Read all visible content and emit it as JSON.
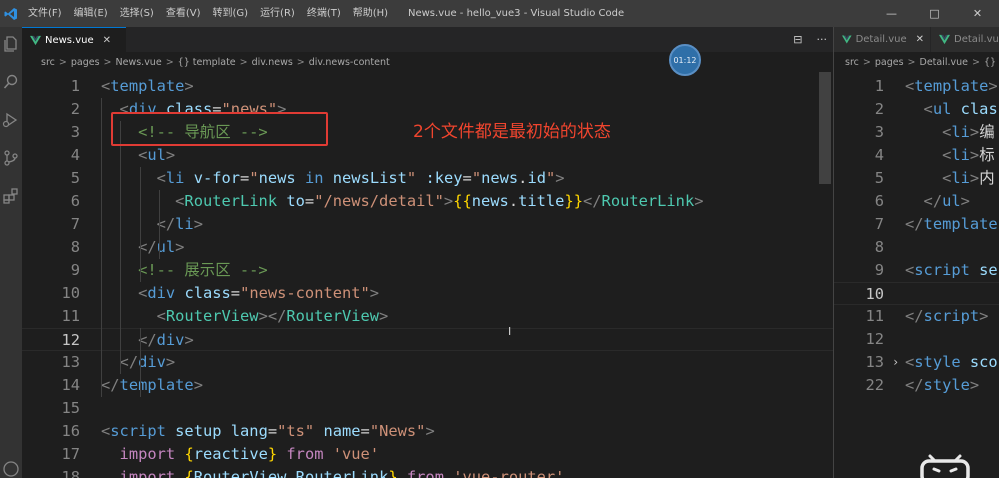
{
  "window": {
    "title": "News.vue - hello_vue3 - Visual Studio Code",
    "menu": [
      "文件(F)",
      "编辑(E)",
      "选择(S)",
      "查看(V)",
      "转到(G)",
      "运行(R)",
      "终端(T)",
      "帮助(H)"
    ],
    "controls": [
      "—",
      "□",
      "✕"
    ]
  },
  "activity_bar": [
    "explorer-icon",
    "search-icon",
    "run-debug-icon",
    "source-control-icon",
    "extensions-icon",
    "account-icon"
  ],
  "editor_left": {
    "tab": {
      "label": "News.vue",
      "close": "✕"
    },
    "actions": [
      "⊟",
      "···"
    ],
    "breadcrumb": [
      "src",
      "pages",
      "News.vue",
      "{} template",
      "div.news",
      "div.news-content"
    ],
    "breadcrumb_sep": ">",
    "line_numbers": [
      "1",
      "2",
      "3",
      "4",
      "5",
      "6",
      "7",
      "8",
      "9",
      "10",
      "11",
      "12",
      "13",
      "14",
      "15",
      "16",
      "17",
      "18"
    ],
    "active_line": "12",
    "code_lines": [
      [
        {
          "t": "<",
          "c": "punct"
        },
        {
          "t": "template",
          "c": "tag"
        },
        {
          "t": ">",
          "c": "punct"
        }
      ],
      [
        {
          "t": "  "
        },
        {
          "t": "<",
          "c": "punct"
        },
        {
          "t": "div",
          "c": "tag"
        },
        {
          "t": " class",
          "c": "attr"
        },
        {
          "t": "=",
          "c": "text"
        },
        {
          "t": "\"news\"",
          "c": "str"
        },
        {
          "t": ">",
          "c": "punct"
        }
      ],
      [
        {
          "t": "    "
        },
        {
          "t": "<!-- 导航区 -->",
          "c": "comment"
        }
      ],
      [
        {
          "t": "    "
        },
        {
          "t": "<",
          "c": "punct"
        },
        {
          "t": "ul",
          "c": "tag"
        },
        {
          "t": ">",
          "c": "punct"
        }
      ],
      [
        {
          "t": "      "
        },
        {
          "t": "<",
          "c": "punct"
        },
        {
          "t": "li",
          "c": "tag"
        },
        {
          "t": " v-for",
          "c": "attr"
        },
        {
          "t": "=",
          "c": "text"
        },
        {
          "t": "\"",
          "c": "str"
        },
        {
          "t": "news",
          "c": "attr"
        },
        {
          "t": " in ",
          "c": "tag"
        },
        {
          "t": "newsList",
          "c": "attr"
        },
        {
          "t": "\"",
          "c": "str"
        },
        {
          "t": " :key",
          "c": "attr"
        },
        {
          "t": "=",
          "c": "text"
        },
        {
          "t": "\"",
          "c": "str"
        },
        {
          "t": "news",
          "c": "attr"
        },
        {
          "t": ".",
          "c": "text"
        },
        {
          "t": "id",
          "c": "attr"
        },
        {
          "t": "\"",
          "c": "str"
        },
        {
          "t": ">",
          "c": "punct"
        }
      ],
      [
        {
          "t": "        "
        },
        {
          "t": "<",
          "c": "punct"
        },
        {
          "t": "RouterLink",
          "c": "comp"
        },
        {
          "t": " to",
          "c": "attr"
        },
        {
          "t": "=",
          "c": "text"
        },
        {
          "t": "\"/news/detail\"",
          "c": "str"
        },
        {
          "t": ">",
          "c": "punct"
        },
        {
          "t": "{{",
          "c": "brace"
        },
        {
          "t": "news",
          "c": "attr"
        },
        {
          "t": ".",
          "c": "text"
        },
        {
          "t": "title",
          "c": "attr"
        },
        {
          "t": "}}",
          "c": "brace"
        },
        {
          "t": "</",
          "c": "punct"
        },
        {
          "t": "RouterLink",
          "c": "comp"
        },
        {
          "t": ">",
          "c": "punct"
        }
      ],
      [
        {
          "t": "      "
        },
        {
          "t": "</",
          "c": "punct"
        },
        {
          "t": "li",
          "c": "tag"
        },
        {
          "t": ">",
          "c": "punct"
        }
      ],
      [
        {
          "t": "    "
        },
        {
          "t": "</",
          "c": "punct"
        },
        {
          "t": "ul",
          "c": "tag"
        },
        {
          "t": ">",
          "c": "punct"
        }
      ],
      [
        {
          "t": "    "
        },
        {
          "t": "<!-- 展示区 -->",
          "c": "comment"
        }
      ],
      [
        {
          "t": "    "
        },
        {
          "t": "<",
          "c": "punct"
        },
        {
          "t": "div",
          "c": "tag"
        },
        {
          "t": " class",
          "c": "attr"
        },
        {
          "t": "=",
          "c": "text"
        },
        {
          "t": "\"news-content\"",
          "c": "str"
        },
        {
          "t": ">",
          "c": "punct"
        }
      ],
      [
        {
          "t": "      "
        },
        {
          "t": "<",
          "c": "punct"
        },
        {
          "t": "RouterView",
          "c": "comp"
        },
        {
          "t": "></",
          "c": "punct"
        },
        {
          "t": "RouterView",
          "c": "comp"
        },
        {
          "t": ">",
          "c": "punct"
        }
      ],
      [
        {
          "t": "    "
        },
        {
          "t": "</",
          "c": "punct"
        },
        {
          "t": "div",
          "c": "tag"
        },
        {
          "t": ">",
          "c": "punct"
        }
      ],
      [
        {
          "t": "  "
        },
        {
          "t": "</",
          "c": "punct"
        },
        {
          "t": "div",
          "c": "tag"
        },
        {
          "t": ">",
          "c": "punct"
        }
      ],
      [
        {
          "t": "</",
          "c": "punct"
        },
        {
          "t": "template",
          "c": "tag"
        },
        {
          "t": ">",
          "c": "punct"
        }
      ],
      [],
      [
        {
          "t": "<",
          "c": "punct"
        },
        {
          "t": "script",
          "c": "tag"
        },
        {
          "t": " setup",
          "c": "attr"
        },
        {
          "t": " lang",
          "c": "attr"
        },
        {
          "t": "=",
          "c": "text"
        },
        {
          "t": "\"ts\"",
          "c": "str"
        },
        {
          "t": " name",
          "c": "attr"
        },
        {
          "t": "=",
          "c": "text"
        },
        {
          "t": "\"News\"",
          "c": "str"
        },
        {
          "t": ">",
          "c": "punct"
        }
      ],
      [
        {
          "t": "  "
        },
        {
          "t": "import",
          "c": "kw"
        },
        {
          "t": " "
        },
        {
          "t": "{",
          "c": "brace"
        },
        {
          "t": "reactive",
          "c": "attr"
        },
        {
          "t": "}",
          "c": "brace"
        },
        {
          "t": " from",
          "c": "kw"
        },
        {
          "t": " 'vue'",
          "c": "str"
        }
      ],
      [
        {
          "t": "  "
        },
        {
          "t": "import",
          "c": "kw"
        },
        {
          "t": " "
        },
        {
          "t": "{",
          "c": "brace"
        },
        {
          "t": "RouterView",
          "c": "attr"
        },
        {
          "t": ",",
          "c": "text"
        },
        {
          "t": "RouterLink",
          "c": "attr"
        },
        {
          "t": "}",
          "c": "brace"
        },
        {
          "t": " from",
          "c": "kw"
        },
        {
          "t": " 'vue-router'",
          "c": "str"
        }
      ]
    ]
  },
  "annotation": {
    "text": "2个文件都是最初始的状态",
    "color": "#e03b34"
  },
  "timer_badge": "01:12",
  "editor_right": {
    "tab": {
      "label": "Detail.vue",
      "close": "✕",
      "second": "Detail.vue"
    },
    "breadcrumb": [
      "src",
      "pages",
      "Detail.vue",
      "{}"
    ],
    "line_numbers": [
      "1",
      "2",
      "3",
      "4",
      "5",
      "6",
      "7",
      "8",
      "9",
      "10",
      "11",
      "12",
      "13",
      "22"
    ],
    "active_line": "10",
    "fold_line": "13",
    "code_lines": [
      [
        {
          "t": "<",
          "c": "punct"
        },
        {
          "t": "template",
          "c": "tag"
        },
        {
          "t": ">",
          "c": "punct"
        }
      ],
      [
        {
          "t": "  "
        },
        {
          "t": "<",
          "c": "punct"
        },
        {
          "t": "ul",
          "c": "tag"
        },
        {
          "t": " class",
          "c": "attr"
        }
      ],
      [
        {
          "t": "    "
        },
        {
          "t": "<",
          "c": "punct"
        },
        {
          "t": "li",
          "c": "tag"
        },
        {
          "t": ">",
          "c": "punct"
        },
        {
          "t": "编",
          "c": "text"
        }
      ],
      [
        {
          "t": "    "
        },
        {
          "t": "<",
          "c": "punct"
        },
        {
          "t": "li",
          "c": "tag"
        },
        {
          "t": ">",
          "c": "punct"
        },
        {
          "t": "标",
          "c": "text"
        }
      ],
      [
        {
          "t": "    "
        },
        {
          "t": "<",
          "c": "punct"
        },
        {
          "t": "li",
          "c": "tag"
        },
        {
          "t": ">",
          "c": "punct"
        },
        {
          "t": "内",
          "c": "text"
        }
      ],
      [
        {
          "t": "  "
        },
        {
          "t": "</",
          "c": "punct"
        },
        {
          "t": "ul",
          "c": "tag"
        },
        {
          "t": ">",
          "c": "punct"
        }
      ],
      [
        {
          "t": "</",
          "c": "punct"
        },
        {
          "t": "template",
          "c": "tag"
        }
      ],
      [],
      [
        {
          "t": "<",
          "c": "punct"
        },
        {
          "t": "script",
          "c": "tag"
        },
        {
          "t": " se",
          "c": "attr"
        }
      ],
      [],
      [
        {
          "t": "</",
          "c": "punct"
        },
        {
          "t": "script",
          "c": "tag"
        },
        {
          "t": ">",
          "c": "punct"
        }
      ],
      [],
      [
        {
          "t": "<",
          "c": "punct"
        },
        {
          "t": "style",
          "c": "tag"
        },
        {
          "t": " sco",
          "c": "attr"
        }
      ],
      [
        {
          "t": "</",
          "c": "punct"
        },
        {
          "t": "style",
          "c": "tag"
        },
        {
          "t": ">",
          "c": "punct"
        }
      ]
    ]
  },
  "colors": {
    "accent": "#0078d4",
    "vue_green": "#41b883",
    "annotation_red": "#e03b34"
  }
}
